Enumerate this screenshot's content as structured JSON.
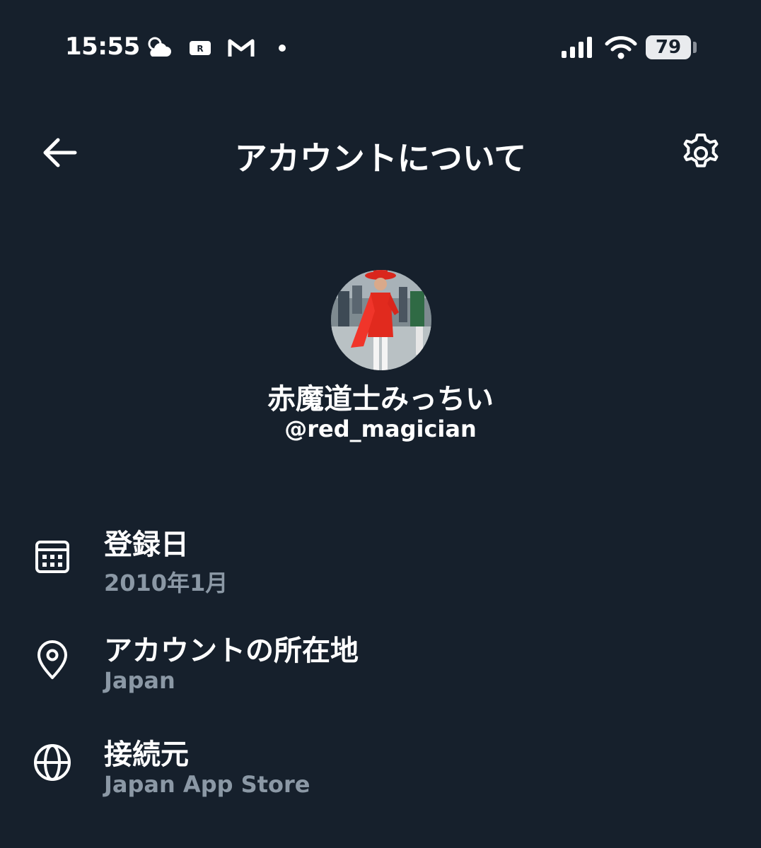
{
  "status_bar": {
    "time": "15:55",
    "battery": "79",
    "icons": [
      "weather-cloud-sun-icon",
      "rakuten-icon",
      "gmail-icon",
      "dot-icon",
      "signal-icon",
      "wifi-icon",
      "battery-icon"
    ]
  },
  "header": {
    "title": "アカウントについて",
    "back_icon": "arrow-left-icon",
    "settings_icon": "gear-icon"
  },
  "profile": {
    "display_name": "赤魔道士みっちい",
    "handle": "@red_magician"
  },
  "info": [
    {
      "icon": "calendar-icon",
      "label": "登録日",
      "value": "2010年1月"
    },
    {
      "icon": "location-pin-icon",
      "label": "アカウントの所在地",
      "value": "Japan"
    },
    {
      "icon": "globe-icon",
      "label": "接続元",
      "value": "Japan App Store"
    }
  ],
  "colors": {
    "background": "#16202c",
    "text_primary": "#ffffff",
    "text_secondary": "#8b98a5"
  }
}
